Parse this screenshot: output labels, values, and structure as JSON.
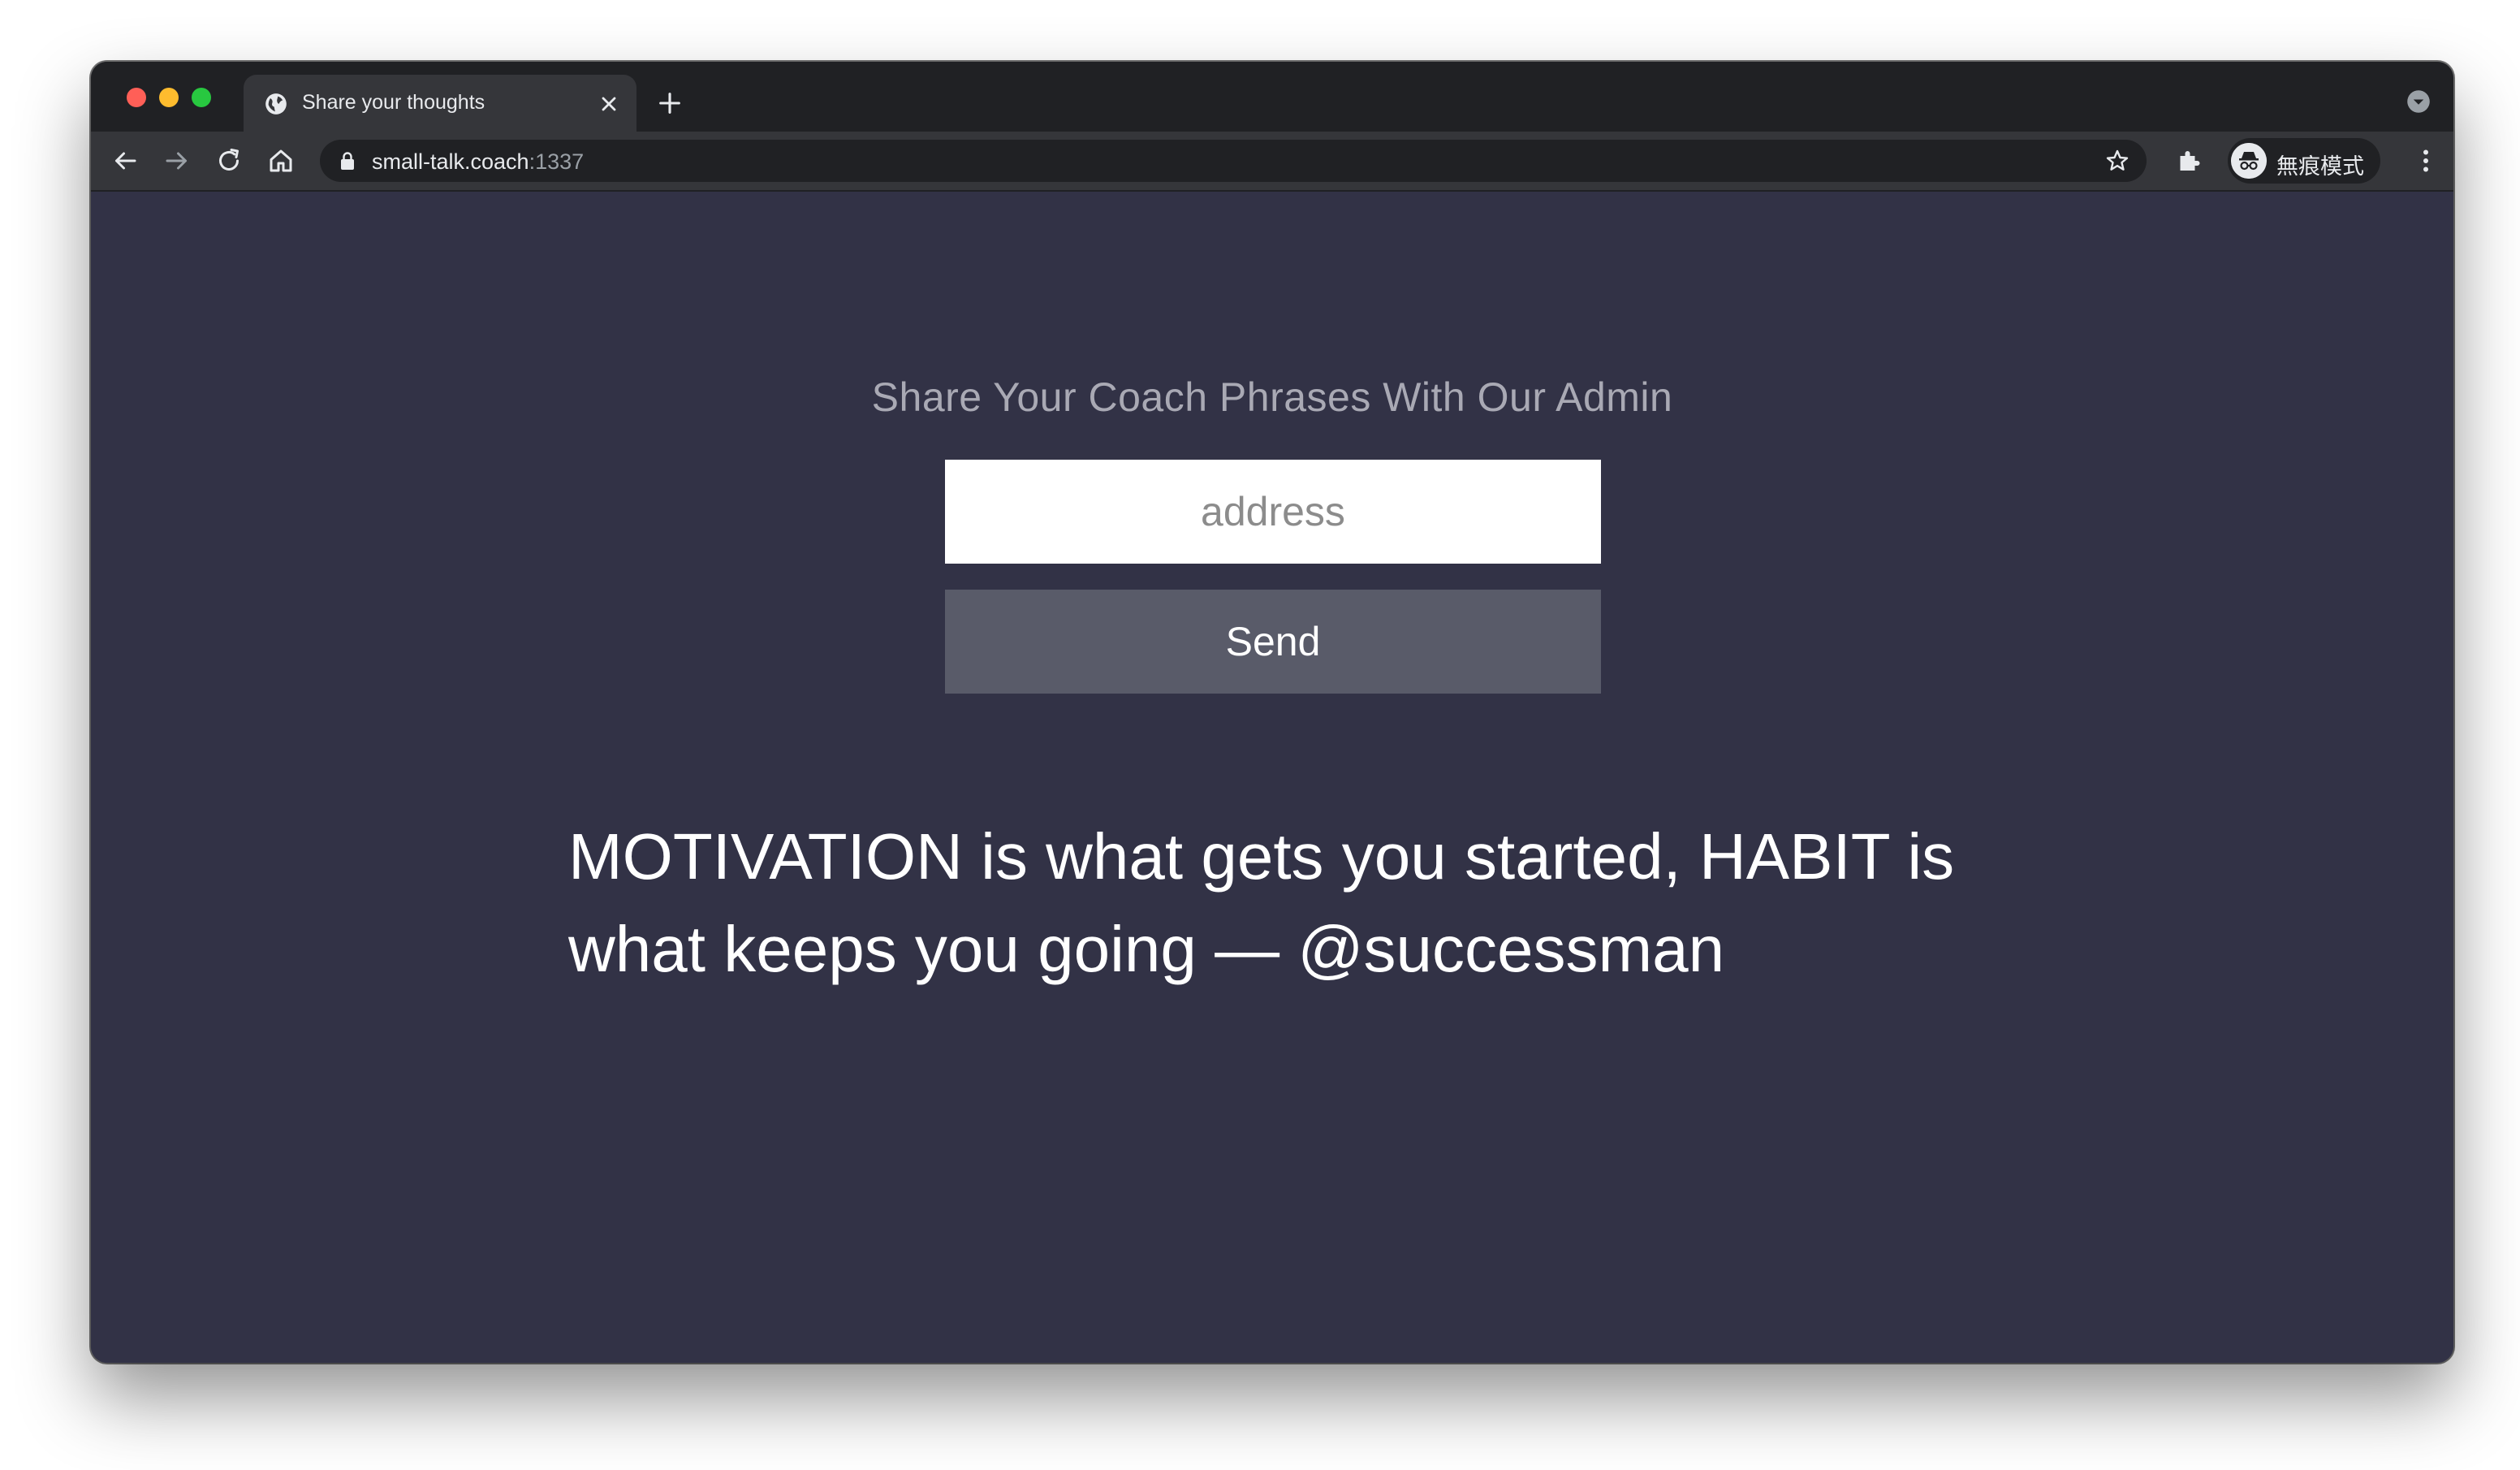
{
  "browser": {
    "tab": {
      "title": "Share your thoughts",
      "favicon": "globe-icon"
    },
    "address_bar": {
      "host": "small-talk.coach",
      "port": ":1337"
    },
    "profile": {
      "label": "無痕模式",
      "icon": "incognito-icon"
    },
    "colors": {
      "tabstrip": "#202124",
      "toolbar": "#35363a"
    }
  },
  "page": {
    "heading": "Share Your Coach Phrases With Our Admin",
    "address_input": {
      "value": "",
      "placeholder": "address"
    },
    "send_label": "Send",
    "quote": "MOTIVATION is what gets you started, HABIT is what keeps you going — @successman",
    "colors": {
      "background": "#323246",
      "button": "#595b69",
      "heading": "#a9a9b4"
    }
  }
}
